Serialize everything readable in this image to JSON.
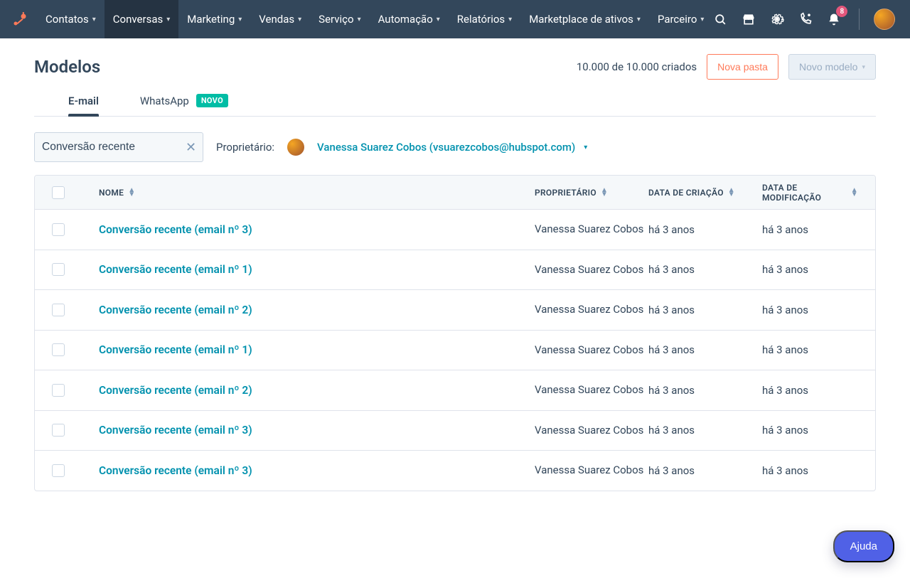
{
  "nav": {
    "items": [
      {
        "label": "Contatos",
        "active": false
      },
      {
        "label": "Conversas",
        "active": true
      },
      {
        "label": "Marketing",
        "active": false
      },
      {
        "label": "Vendas",
        "active": false
      },
      {
        "label": "Serviço",
        "active": false
      },
      {
        "label": "Automação",
        "active": false
      },
      {
        "label": "Relatórios",
        "active": false
      },
      {
        "label": "Marketplace de ativos",
        "active": false
      },
      {
        "label": "Parceiro",
        "active": false
      }
    ],
    "notification_count": "8"
  },
  "page": {
    "title": "Modelos",
    "count_text": "10.000 de 10.000 criados",
    "new_folder_label": "Nova pasta",
    "new_model_label": "Novo modelo"
  },
  "tabs": {
    "email": "E-mail",
    "whatsapp": "WhatsApp",
    "new_badge": "NOVO"
  },
  "filter": {
    "search_value": "Conversão recente",
    "owner_label": "Proprietário:",
    "owner_name": "Vanessa Suarez Cobos (vsuarezcobos@hubspot.com)"
  },
  "table": {
    "headers": {
      "name": "NOME",
      "owner": "PROPRIETÁRIO",
      "created": "DATA DE CRIAÇÃO",
      "modified": "DATA DE MODIFICAÇÃO"
    },
    "rows": [
      {
        "name": "Conversão recente (email nº 3)",
        "owner": "Vanessa Suarez Cobos",
        "created": "há 3 anos",
        "modified": "há 3 anos"
      },
      {
        "name": "Conversão recente (email nº 1)",
        "owner": "Vanessa Suarez Cobos",
        "created": "há 3 anos",
        "modified": "há 3 anos"
      },
      {
        "name": "Conversão recente (email nº 2)",
        "owner": "Vanessa Suarez Cobos",
        "created": "há 3 anos",
        "modified": "há 3 anos"
      },
      {
        "name": "Conversão recente (email nº 1)",
        "owner": "Vanessa Suarez Cobos",
        "created": "há 3 anos",
        "modified": "há 3 anos"
      },
      {
        "name": "Conversão recente (email nº 2)",
        "owner": "Vanessa Suarez Cobos",
        "created": "há 3 anos",
        "modified": "há 3 anos"
      },
      {
        "name": "Conversão recente (email nº 3)",
        "owner": "Vanessa Suarez Cobos",
        "created": "há 3 anos",
        "modified": "há 3 anos"
      },
      {
        "name": "Conversão recente (email nº 3)",
        "owner": "Vanessa Suarez Cobos",
        "created": "há 3 anos",
        "modified": "há 3 anos"
      }
    ]
  },
  "help_label": "Ajuda"
}
